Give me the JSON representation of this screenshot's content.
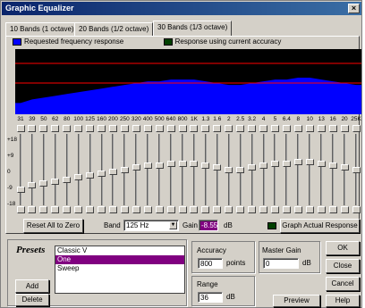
{
  "window": {
    "title": "Graphic Equalizer",
    "close_glyph": "×"
  },
  "tabs": [
    {
      "label": "10 Bands (1 octave)"
    },
    {
      "label": "20 Bands (1/2 octave)"
    },
    {
      "label": "30 Bands (1/3 octave)",
      "active": true
    }
  ],
  "legend": {
    "requested": "Requested frequency response",
    "current": "Response using current accuracy",
    "requested_color": "#0000ff",
    "current_color": "#004000"
  },
  "graph": {
    "background": "#000000",
    "fill_color": "#0000ff",
    "line_color": "#ff0000"
  },
  "bands": [
    "31",
    "39",
    "50",
    "62",
    "80",
    "100",
    "125",
    "160",
    "200",
    "250",
    "320",
    "400",
    "500",
    "640",
    "800",
    "1K",
    "1.3",
    "1.6",
    "2",
    "2.5",
    "3.2",
    "4",
    "5",
    "6.4",
    "8",
    "10",
    "13",
    "16",
    "20",
    "25K"
  ],
  "band_gains": [
    -10,
    -8,
    -7,
    -6,
    -5,
    -4,
    -3,
    -2,
    -1,
    0,
    1,
    2,
    2,
    3,
    3,
    3,
    2,
    1,
    0,
    0,
    1,
    2,
    3,
    3,
    4,
    4,
    3,
    2,
    1,
    0
  ],
  "scale_ticks": [
    "+18",
    "+9",
    "0",
    "-9",
    "-18"
  ],
  "controls": {
    "reset_label": "Reset All to Zero",
    "band_label": "Band",
    "band_value": "125 Hz",
    "gain_label": "Gain",
    "gain_value": "-8.55",
    "gain_unit": "dB",
    "graph_actual_label": "Graph Actual Response"
  },
  "presets": {
    "title": "Presets",
    "items": [
      "Classic V",
      "One",
      "Sweep"
    ],
    "selected_index": 1,
    "add_label": "Add",
    "delete_label": "Delete"
  },
  "accuracy": {
    "label": "Accuracy",
    "value": "800",
    "unit": "points"
  },
  "range": {
    "label": "Range",
    "value": "36",
    "unit": "dB"
  },
  "master_gain": {
    "label": "Master Gain",
    "value": "0",
    "unit": "dB"
  },
  "buttons": {
    "ok": "OK",
    "close": "Close",
    "cancel": "Cancel",
    "preview": "Preview",
    "help": "Help"
  }
}
